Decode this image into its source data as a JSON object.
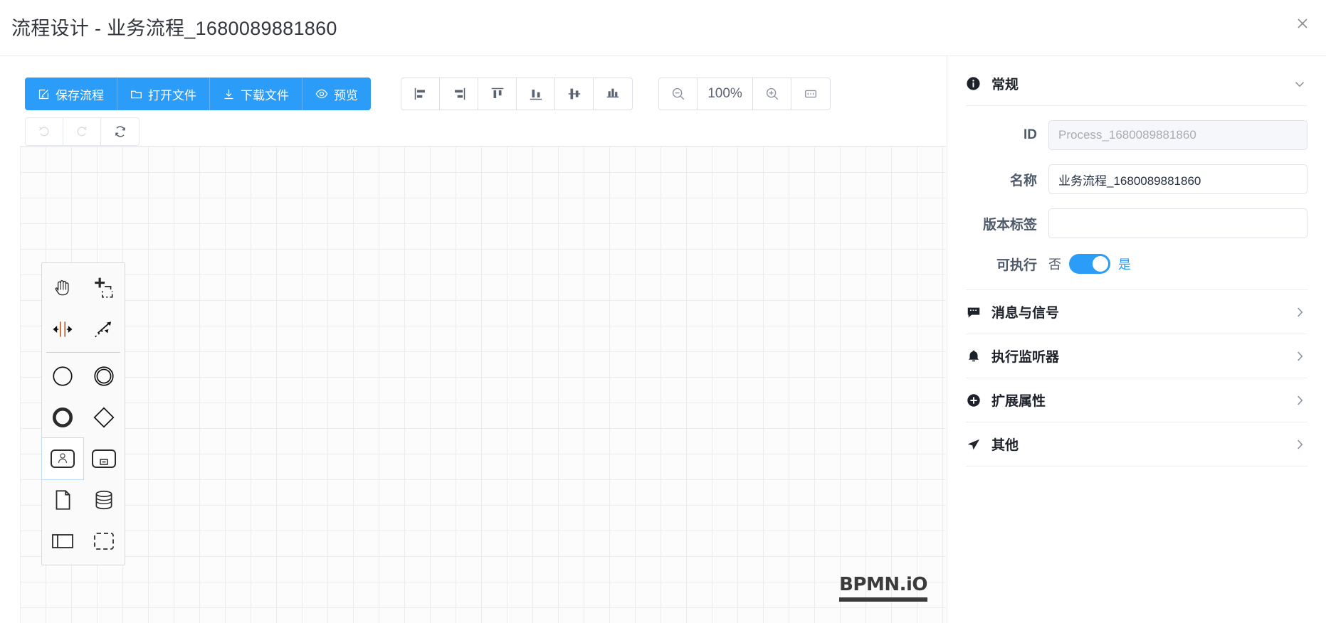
{
  "window": {
    "title": "流程设计 - 业务流程_1680089881860",
    "close_icon": "close-icon"
  },
  "toolbar": {
    "primary_buttons": [
      {
        "label": "保存流程",
        "icon": "edit-square-icon"
      },
      {
        "label": "打开文件",
        "icon": "folder-open-icon"
      },
      {
        "label": "下载文件",
        "icon": "download-icon"
      },
      {
        "label": "预览",
        "icon": "eye-icon"
      }
    ],
    "align_buttons": [
      {
        "name": "align-left-icon"
      },
      {
        "name": "align-right-icon"
      },
      {
        "name": "align-top-icon"
      },
      {
        "name": "align-bottom-icon"
      },
      {
        "name": "align-center-horizontal-icon"
      },
      {
        "name": "align-center-vertical-icon"
      }
    ],
    "zoom": {
      "zoom_out_icon": "zoom-out-icon",
      "level": "100%",
      "zoom_in_icon": "zoom-in-icon",
      "fit_icon": "fit-screen-icon"
    },
    "history_buttons": [
      {
        "name": "undo-icon",
        "enabled": false
      },
      {
        "name": "redo-icon",
        "enabled": false
      },
      {
        "name": "refresh-icon",
        "enabled": true
      }
    ]
  },
  "canvas": {
    "watermark": "BPMN.iO",
    "palette": [
      {
        "name": "hand-tool-icon"
      },
      {
        "name": "lasso-tool-icon"
      },
      {
        "name": "space-tool-icon"
      },
      {
        "name": "global-connect-tool-icon"
      },
      {
        "name": "start-event-icon"
      },
      {
        "name": "intermediate-event-icon"
      },
      {
        "name": "end-event-icon"
      },
      {
        "name": "gateway-icon"
      },
      {
        "name": "user-task-icon"
      },
      {
        "name": "sub-process-icon"
      },
      {
        "name": "data-object-icon"
      },
      {
        "name": "data-store-icon"
      },
      {
        "name": "participant-pool-icon"
      },
      {
        "name": "group-icon"
      }
    ]
  },
  "panel": {
    "general": {
      "title": "常规",
      "icon": "info-icon",
      "expanded": true,
      "fields": {
        "id_label": "ID",
        "id_value": "Process_1680089881860",
        "name_label": "名称",
        "name_value": "业务流程_1680089881860",
        "version_label": "版本标签",
        "version_value": "",
        "executable_label": "可执行",
        "executable_off": "否",
        "executable_on": "是",
        "executable_state": true
      }
    },
    "sections": [
      {
        "title": "消息与信号",
        "icon": "message-icon"
      },
      {
        "title": "执行监听器",
        "icon": "bell-icon"
      },
      {
        "title": "扩展属性",
        "icon": "plus-circle-icon"
      },
      {
        "title": "其他",
        "icon": "send-icon"
      }
    ]
  },
  "colors": {
    "primary": "#2b9cf7",
    "text": "#1d2129",
    "muted": "#8a939f"
  }
}
